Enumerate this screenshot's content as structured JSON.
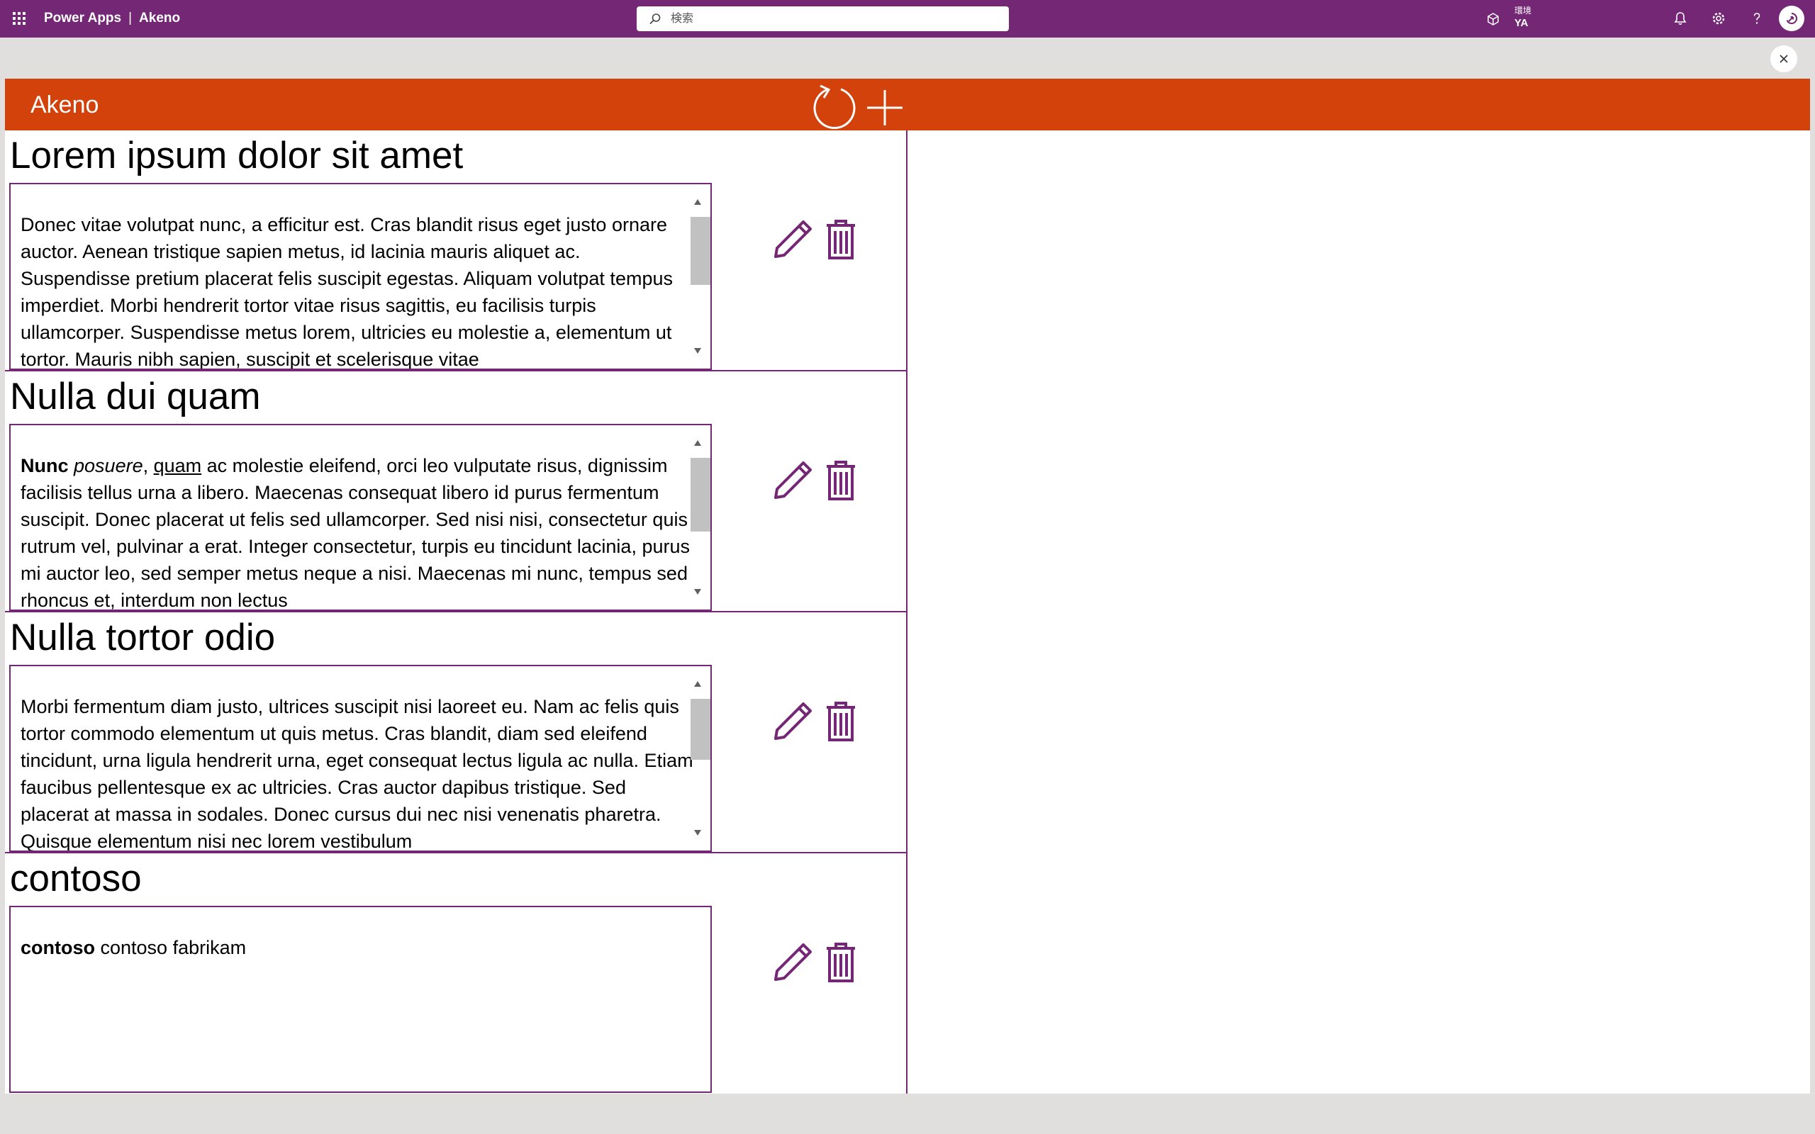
{
  "topbar": {
    "app_name": "Power Apps",
    "separator": "|",
    "env_short": "Akeno",
    "search_placeholder": "検索",
    "environment_label": "環境",
    "environment_name": "YA",
    "icons": [
      "waffle-icon",
      "search-icon",
      "environment-icon",
      "bell-icon",
      "gear-icon",
      "help-icon",
      "avatar-icon"
    ],
    "brand_color": "#742774"
  },
  "app": {
    "title": "Akeno",
    "header_color": "#d4420c",
    "accent_color": "#742774",
    "items": [
      {
        "title": "Lorem ipsum dolor sit amet",
        "body_html": "Donec vitae volutpat nunc, a efficitur est. Cras blandit risus eget justo ornare auctor. Aenean tristique sapien metus, id lacinia mauris aliquet ac. Suspendisse pretium placerat felis suscipit egestas. Aliquam volutpat tempus imperdiet. Morbi hendrerit tortor vitae risus sagittis, eu facilisis turpis ullamcorper. Suspendisse metus lorem, ultricies eu molestie a, elementum ut tortor. Mauris nibh sapien, suscipit et scelerisque vitae",
        "scrollable": true
      },
      {
        "title": "Nulla dui quam",
        "body_html": "<b>Nunc</b> <i>posuere</i>, <u>quam</u> ac molestie eleifend, orci leo vulputate risus, dignissim facilisis tellus urna a libero. Maecenas consequat libero id purus fermentum suscipit. Donec placerat ut felis sed ullamcorper. Sed nisi nisi, consectetur quis rutrum vel, pulvinar a erat. Integer consectetur, turpis eu tincidunt lacinia, purus mi auctor leo, sed semper metus neque a nisi. Maecenas mi nunc, tempus sed rhoncus et, interdum non lectus",
        "scrollable": true
      },
      {
        "title": "Nulla tortor odio",
        "body_html": "Morbi fermentum diam justo, ultrices suscipit nisi laoreet eu. Nam ac felis quis tortor commodo elementum ut quis metus. Cras blandit, diam sed eleifend tincidunt, urna ligula hendrerit urna, eget consequat lectus ligula ac nulla. Etiam faucibus pellentesque ex ac ultricies. Cras auctor dapibus tristique. Sed placerat at massa in sodales. Donec cursus dui nec nisi venenatis pharetra. Quisque elementum nisi nec lorem vestibulum",
        "scrollable": true
      },
      {
        "title": "contoso",
        "body_html": "<b>contoso</b> contoso fabrikam",
        "scrollable": false
      }
    ]
  }
}
